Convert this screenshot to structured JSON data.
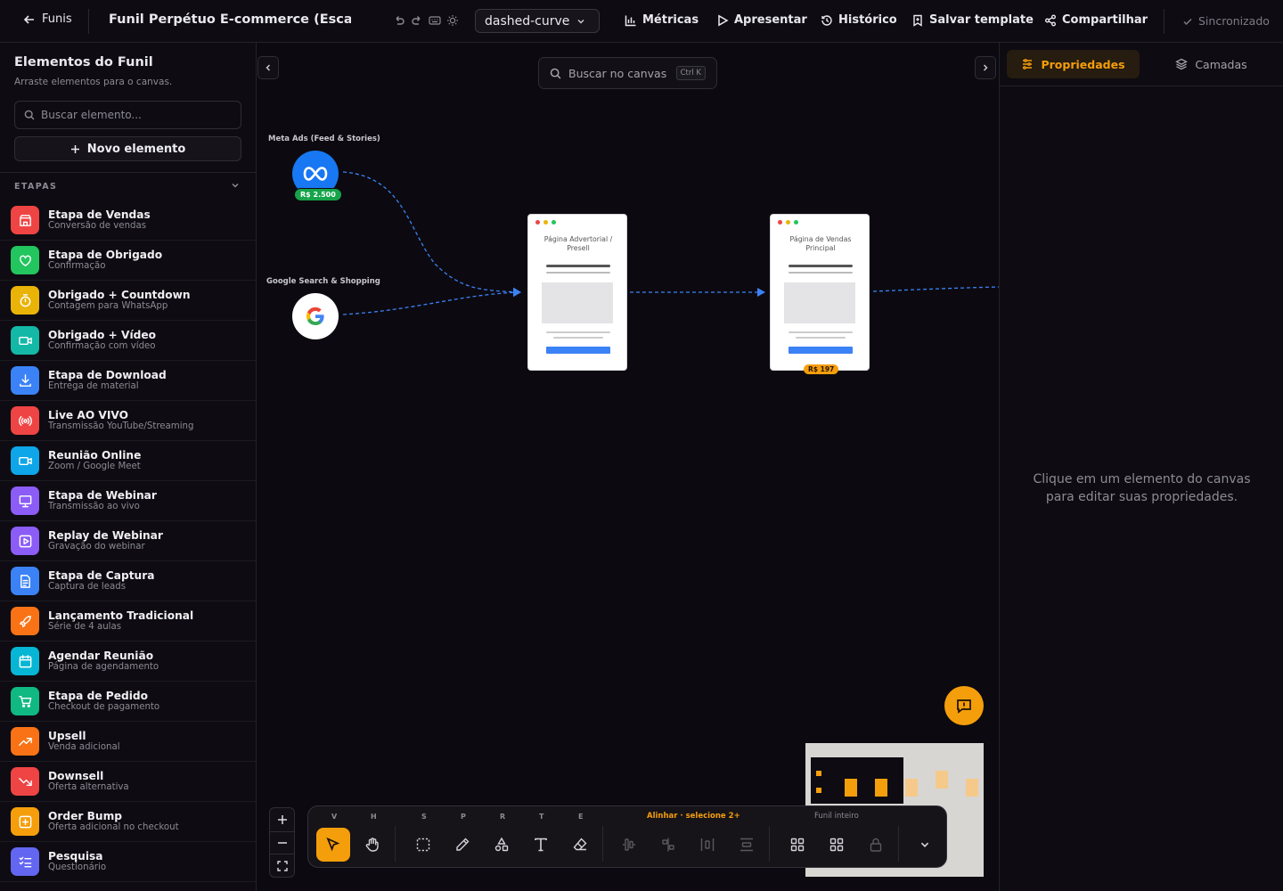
{
  "topbar": {
    "back_label": "Funis",
    "funnel_title": "Funil Perpétuo E-commerce (Escala ...",
    "edge_style": "dashed-curve",
    "metrics": "Métricas",
    "present": "Apresentar",
    "history": "Histórico",
    "save_template": "Salvar template",
    "share": "Compartilhar",
    "sync_status": "Sincronizado"
  },
  "sidebar": {
    "title": "Elementos do Funil",
    "subtitle": "Arraste elementos para o canvas.",
    "search_placeholder": "Buscar elemento...",
    "new_element": "Novo elemento",
    "section": "ETAPAS",
    "stages": [
      {
        "name": "Etapa de Vendas",
        "desc": "Conversão de vendas",
        "color": "#ef4444",
        "icon": "store-icon"
      },
      {
        "name": "Etapa de Obrigado",
        "desc": "Confirmação",
        "color": "#22c55e",
        "icon": "heart-icon"
      },
      {
        "name": "Obrigado + Countdown",
        "desc": "Contagem para WhatsApp",
        "color": "#eab308",
        "icon": "timer-icon"
      },
      {
        "name": "Obrigado + Vídeo",
        "desc": "Confirmação com vídeo",
        "color": "#14b8a6",
        "icon": "video-icon"
      },
      {
        "name": "Etapa de Download",
        "desc": "Entrega de material",
        "color": "#3b82f6",
        "icon": "download-icon"
      },
      {
        "name": "Live AO VIVO",
        "desc": "Transmissão YouTube/Streaming",
        "color": "#ef4444",
        "icon": "broadcast-icon"
      },
      {
        "name": "Reunião Online",
        "desc": "Zoom / Google Meet",
        "color": "#0ea5e9",
        "icon": "camera-icon"
      },
      {
        "name": "Etapa de Webinar",
        "desc": "Transmissão ao vivo",
        "color": "#8b5cf6",
        "icon": "presentation-icon"
      },
      {
        "name": "Replay de Webinar",
        "desc": "Gravação do webinar",
        "color": "#8b5cf6",
        "icon": "replay-icon"
      },
      {
        "name": "Etapa de Captura",
        "desc": "Captura de leads",
        "color": "#3b82f6",
        "icon": "document-icon"
      },
      {
        "name": "Lançamento Tradicional",
        "desc": "Série de 4 aulas",
        "color": "#f97316",
        "icon": "rocket-icon"
      },
      {
        "name": "Agendar Reunião",
        "desc": "Página de agendamento",
        "color": "#06b6d4",
        "icon": "calendar-icon"
      },
      {
        "name": "Etapa de Pedido",
        "desc": "Checkout de pagamento",
        "color": "#10b981",
        "icon": "cart-icon"
      },
      {
        "name": "Upsell",
        "desc": "Venda adicional",
        "color": "#f97316",
        "icon": "trend-up-icon"
      },
      {
        "name": "Downsell",
        "desc": "Oferta alternativa",
        "color": "#ef4444",
        "icon": "trend-down-icon"
      },
      {
        "name": "Order Bump",
        "desc": "Oferta adicional no checkout",
        "color": "#f59e0b",
        "icon": "plus-square-icon"
      },
      {
        "name": "Pesquisa",
        "desc": "Questionário",
        "color": "#6366f1",
        "icon": "checklist-icon"
      }
    ]
  },
  "canvas": {
    "search_placeholder": "Buscar no canvas",
    "search_shortcut": "Ctrl K",
    "sources": [
      {
        "label": "Meta Ads (Feed & Stories)",
        "cost": "R$ 2.500",
        "icon": "meta-icon"
      },
      {
        "label": "Google Search & Shopping",
        "icon": "google-icon"
      }
    ],
    "pages": [
      {
        "title": "Página Advertorial / Presell"
      },
      {
        "title": "Página de Vendas Principal",
        "price": "R$ 197"
      }
    ],
    "colors": {
      "accent": "#f59e0b",
      "edge": "#3b82f6",
      "cost_badge": "#16a34a"
    }
  },
  "toolbar": {
    "keys": {
      "select": "V",
      "hand": "H",
      "marquee": "S",
      "pen": "P",
      "shapes": "R",
      "text": "T",
      "eraser": "E"
    },
    "align_label": "Alinhar · selecione 2+",
    "whole_funnel_label": "Funil inteiro"
  },
  "right_panel": {
    "tab_properties": "Propriedades",
    "tab_layers": "Camadas",
    "empty_message": "Clique em um elemento do canvas para editar suas propriedades."
  }
}
